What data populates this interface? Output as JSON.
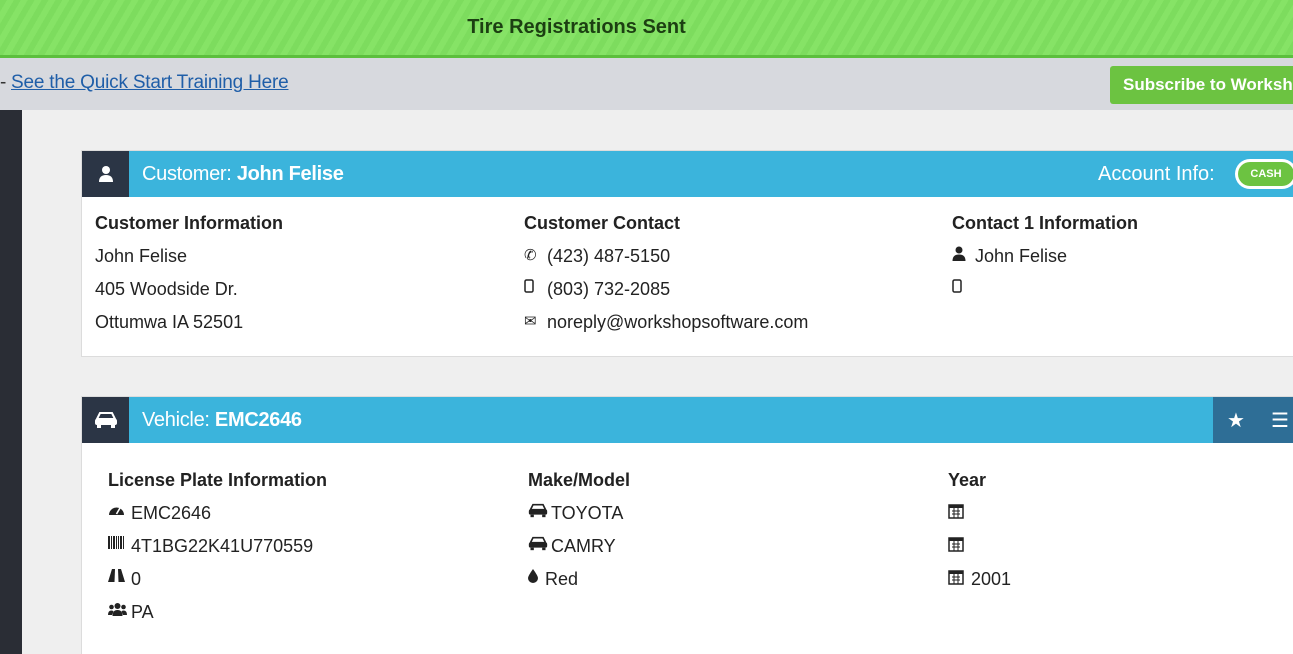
{
  "banner": {
    "title": "Tire Registrations Sent"
  },
  "topbar": {
    "dash": "-",
    "training_link": "See the Quick Start Training Here",
    "subscribe_label": "Subscribe to Workshop"
  },
  "customer_panel": {
    "label": "Customer:",
    "name": "John Felise",
    "account_label": "Account Info:",
    "account_badge": "CASH",
    "info_heading": "Customer Information",
    "info_lines": [
      "John Felise",
      "405 Woodside Dr.",
      "Ottumwa IA 52501"
    ],
    "contact_heading": "Customer Contact",
    "phone": "(423) 487-5150",
    "mobile": "(803) 732-2085",
    "email": "noreply@workshopsoftware.com",
    "contact1_heading": "Contact 1 Information",
    "contact1_name": "John Felise",
    "contact1_mobile": ""
  },
  "vehicle_panel": {
    "label": "Vehicle:",
    "plate": "EMC2646",
    "plate_heading": "License Plate Information",
    "plate_value": "EMC2646",
    "vin": "4T1BG22K41U770559",
    "odometer": "0",
    "state": "PA",
    "makemodel_heading": "Make/Model",
    "make": "TOYOTA",
    "model": "CAMRY",
    "color": "Red",
    "year_heading": "Year",
    "year_line1": "",
    "year_line2": "",
    "year": "2001"
  },
  "icons": [
    "user-icon",
    "car-icon",
    "phone-icon",
    "mobile-icon",
    "envelope-icon",
    "person-icon",
    "dashboard-icon",
    "barcode-icon",
    "road-icon",
    "group-icon",
    "tint-icon",
    "calendar-icon",
    "star-icon",
    "list-icon"
  ],
  "colors": {
    "banner_green": "#7ddc5e",
    "header_blue": "#3bb4dc",
    "dark": "#2b3545",
    "accent_green": "#6cc341"
  }
}
